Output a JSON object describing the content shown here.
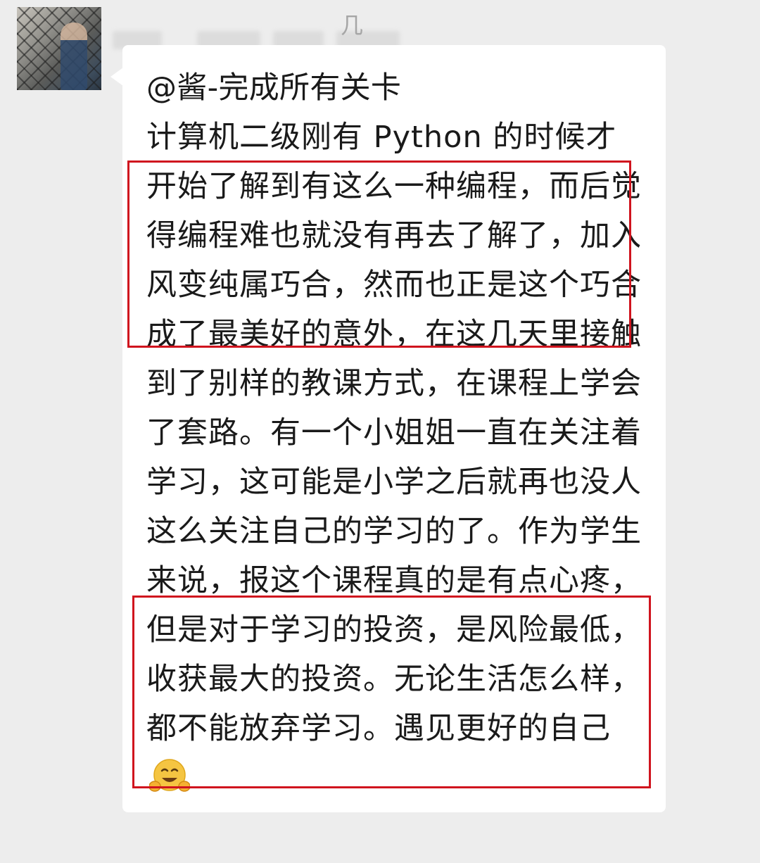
{
  "message": {
    "sender_name_visible": "几",
    "mention": "@酱-完成所有关卡",
    "body": "计算机二级刚有 Python 的时候才开始了解到有这么一种编程，而后觉得编程难也就没有再去了解了，加入风变纯属巧合，然而也正是这个巧合成了最美好的意外，在这几天里接触到了别样的教课方式，在课程上学会了套路。有一个小姐姐一直在关注着学习，这可能是小学之后就再也没人这么关注自己的学习的了。作为学生来说，报这个课程真的是有点心疼，但是对于学习的投资，是风险最低，收获最大的投资。无论生活怎么样，都不能放弃学习。遇见更好的自己",
    "trailing_emoji": "hugging-face-emoji"
  },
  "colors": {
    "chat_background": "#ededed",
    "bubble_background": "#ffffff",
    "highlight_border": "#d0141e"
  }
}
